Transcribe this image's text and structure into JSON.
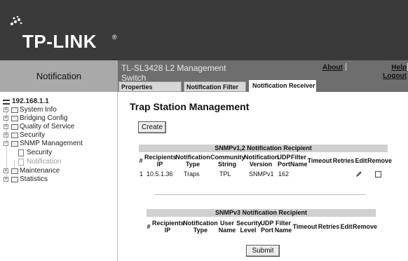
{
  "brand": {
    "logo_text": "TP-LINK",
    "logo_mark": "®"
  },
  "header": {
    "left_title": "Notification",
    "device_name": "TL-SL3428 L2 Management Switch",
    "about_label": "About",
    "help_label": "Help",
    "logout_label": "Logout"
  },
  "tabs": [
    {
      "label": "Properties"
    },
    {
      "label": "Notification Filter"
    },
    {
      "label": "Notification Receiver"
    }
  ],
  "nav": {
    "root_label": "192.168.1.1",
    "items": [
      {
        "label": "System Info"
      },
      {
        "label": "Bridging Config"
      },
      {
        "label": "Quality of Service"
      },
      {
        "label": "Security"
      },
      {
        "label": "SNMP Management"
      },
      {
        "label": "Security"
      },
      {
        "label": "Notification"
      },
      {
        "label": "Maintenance"
      },
      {
        "label": "Statistics"
      }
    ]
  },
  "main": {
    "title": "Trap Station Management",
    "create_label": "Create",
    "submit_label": "Submit",
    "table_v1": {
      "caption": "SNMPv1,2 Notification Recipient",
      "headers": [
        "#",
        "Recipients IP",
        "Notification Type",
        "Community String",
        "Notification Version",
        "UDP Port",
        "Filter Name",
        "Timeout",
        "Retries",
        "Edit",
        "Remove"
      ],
      "rows": [
        {
          "num": "1",
          "ip": "10.5.1.36",
          "type": "Traps",
          "community": "TPL",
          "version": "SNMPv1",
          "port": "162"
        }
      ]
    },
    "table_v3": {
      "caption": "SNMPv3 Notification Recipient",
      "headers": [
        "#",
        "Recipients IP",
        "Notification Type",
        "User Name",
        "Security Level",
        "UDP Port",
        "Filter Name",
        "Timeout",
        "Retries",
        "Edit",
        "Remove"
      ]
    }
  },
  "colors": {
    "banner": "#3a3a3a",
    "left_header": "#a9a9a9",
    "right_header": "#6e6e6e",
    "caption_bg": "#d0d0d0",
    "tab_inactive": "#d7d7d7"
  },
  "icons": {
    "tree_expand": "plus-box-icon",
    "tree_collapse": "minus-box-icon",
    "folder": "folder-icon",
    "page": "page-icon",
    "edit": "pencil-icon"
  }
}
